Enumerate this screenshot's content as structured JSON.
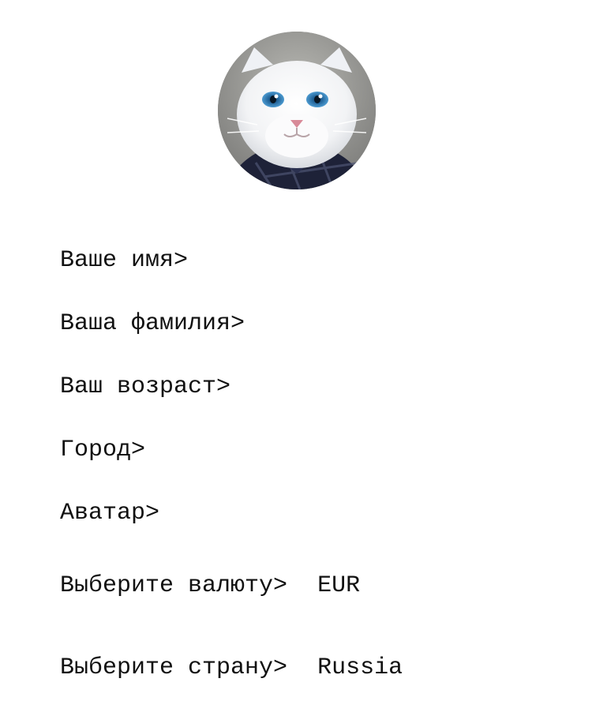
{
  "profile": {
    "avatar_alt": "cat-in-shirt-avatar"
  },
  "form": {
    "first_name_label": "Ваше имя>",
    "last_name_label": "Ваша фамилия>",
    "age_label": "Ваш возраст>",
    "city_label": "Город>",
    "avatar_label": "Аватар>",
    "currency_label": "Выберите валюту>",
    "currency_value": "EUR",
    "country_label": "Выберите страну>",
    "country_value": "Russia"
  }
}
